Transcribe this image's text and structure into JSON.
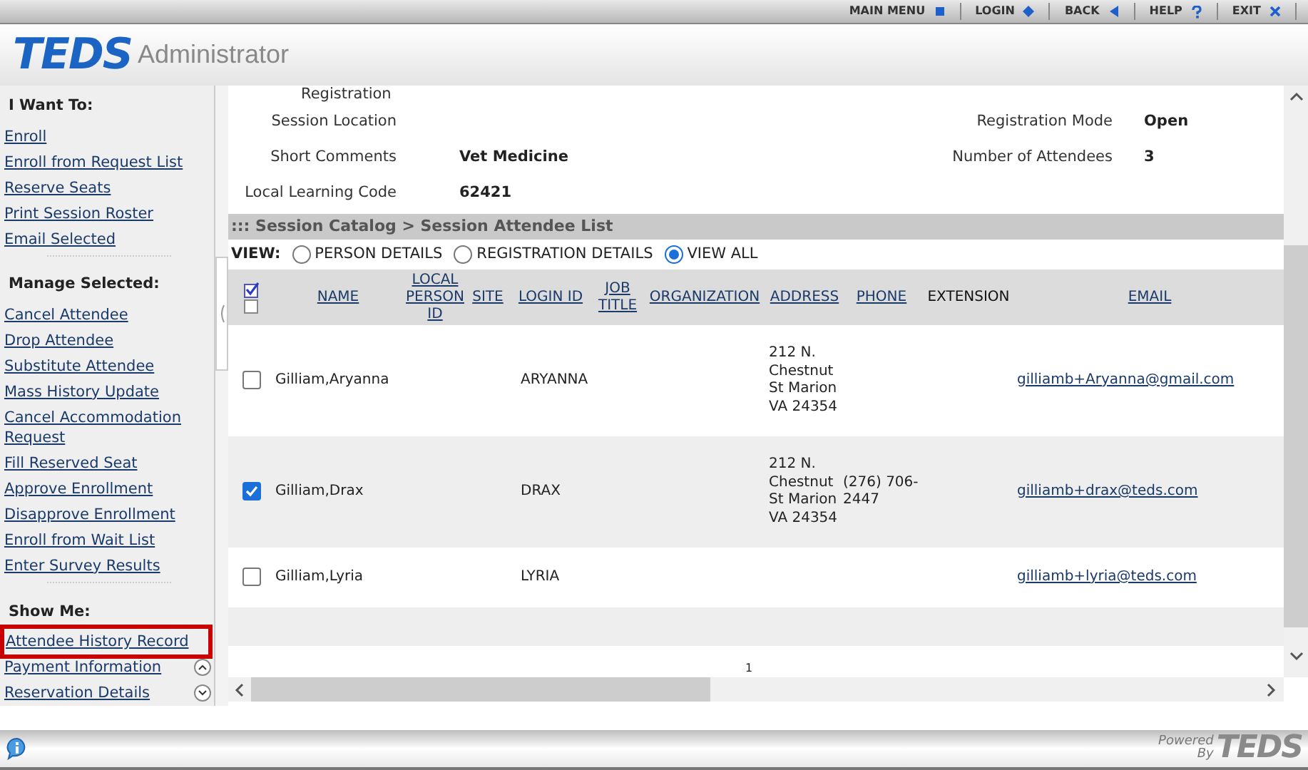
{
  "top_nav": [
    {
      "label": "MAIN MENU"
    },
    {
      "label": "LOGIN"
    },
    {
      "label": "BACK"
    },
    {
      "label": "HELP"
    },
    {
      "label": "EXIT"
    }
  ],
  "header": {
    "logo": "TEDS",
    "title": "Administrator"
  },
  "sidebar": [
    {
      "heading": "I Want To:",
      "items": [
        {
          "label": "Enroll",
          "highlighted": false
        },
        {
          "label": "Enroll from Request List",
          "highlighted": false
        },
        {
          "label": "Reserve Seats",
          "highlighted": false
        },
        {
          "label": "Print Session Roster",
          "highlighted": false
        },
        {
          "label": "Email Selected",
          "highlighted": false
        }
      ]
    },
    {
      "heading": "Manage Selected:",
      "items": [
        {
          "label": "Cancel Attendee",
          "highlighted": false
        },
        {
          "label": "Drop Attendee",
          "highlighted": false
        },
        {
          "label": "Substitute Attendee",
          "highlighted": false
        },
        {
          "label": "Mass History Update",
          "highlighted": false
        },
        {
          "label": "Cancel Accommodation Request",
          "highlighted": false
        },
        {
          "label": "Fill Reserved Seat",
          "highlighted": false
        },
        {
          "label": "Approve Enrollment",
          "highlighted": false
        },
        {
          "label": "Disapprove Enrollment",
          "highlighted": false
        },
        {
          "label": "Enroll from Wait List",
          "highlighted": false
        },
        {
          "label": "Enter Survey Results",
          "highlighted": false
        }
      ]
    },
    {
      "heading": "Show Me:",
      "items": [
        {
          "label": "Attendee History Record",
          "highlighted": true
        },
        {
          "label": "Payment Information",
          "highlighted": false
        },
        {
          "label": "Reservation Details",
          "highlighted": false
        }
      ]
    }
  ],
  "details": {
    "top_label": "Registration",
    "rows": [
      {
        "label": "Session Location",
        "value": "",
        "label_2": "Registration Mode",
        "value_2": "Open"
      },
      {
        "label": "Short Comments",
        "value": "Vet Medicine",
        "label_2": "Number of Attendees",
        "value_2": "3"
      },
      {
        "label": "Local Learning Code",
        "value": "62421",
        "label_2": "",
        "value_2": ""
      }
    ]
  },
  "section_title": "::: Session Catalog > Session Attendee List",
  "view": {
    "label": "VIEW:",
    "options": [
      {
        "label": "PERSON DETAILS",
        "selected": false
      },
      {
        "label": "REGISTRATION DETAILS",
        "selected": false
      },
      {
        "label": "VIEW ALL",
        "selected": true
      }
    ]
  },
  "table": {
    "header_checkbox": {
      "checked": false
    },
    "columns": [
      {
        "label": "NAME",
        "kind": "link"
      },
      {
        "label": "LOCAL PERSON ID",
        "kind": "link"
      },
      {
        "label": "SITE",
        "kind": "link"
      },
      {
        "label": "LOGIN ID",
        "kind": "link"
      },
      {
        "label": "JOB TITLE",
        "kind": "link"
      },
      {
        "label": "ORGANIZATION",
        "kind": "link"
      },
      {
        "label": "ADDRESS",
        "kind": "link"
      },
      {
        "label": "PHONE",
        "kind": "link"
      },
      {
        "label": "EXTENSION",
        "kind": "plain"
      },
      {
        "label": "EMAIL",
        "kind": "link"
      }
    ],
    "rows": [
      {
        "checked": false,
        "cells": [
          "Gilliam,Aryanna",
          "",
          "",
          "ARYANNA",
          "",
          "",
          "212 N. Chestnut St Marion VA 24354",
          "",
          "",
          "gilliamb+Aryanna@gmail.com"
        ]
      },
      {
        "checked": true,
        "cells": [
          "Gilliam,Drax",
          "",
          "",
          "DRAX",
          "",
          "",
          "212 N. Chestnut St Marion VA 24354",
          "(276) 706-2447",
          "",
          "gilliamb+drax@teds.com"
        ]
      },
      {
        "checked": false,
        "cells": [
          "Gilliam,Lyria",
          "",
          "",
          "LYRIA",
          "",
          "",
          "",
          "",
          "",
          "gilliamb+lyria@teds.com"
        ]
      }
    ]
  },
  "pagination": [
    "1"
  ],
  "footer": {
    "powered": "Powered By",
    "logo": "TEDS"
  }
}
